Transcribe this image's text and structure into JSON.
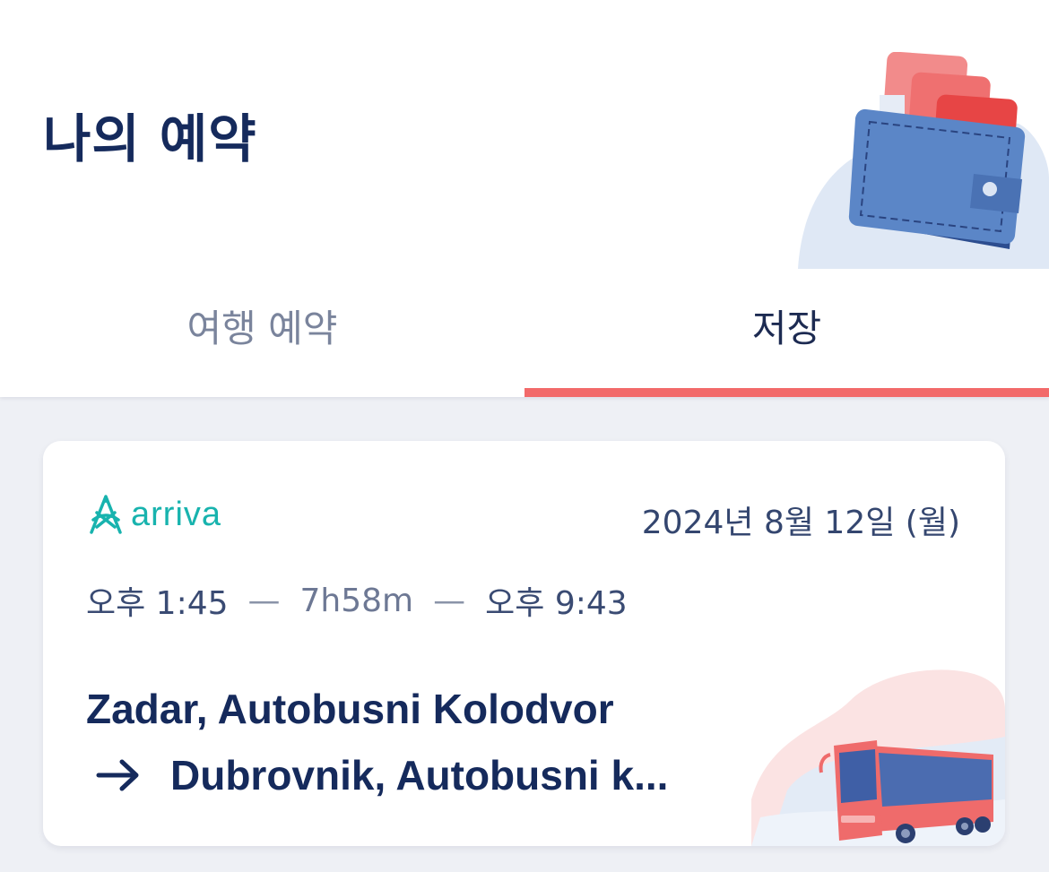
{
  "header": {
    "title": "나의 예약"
  },
  "tabs": [
    {
      "label": "여행 예약",
      "active": false
    },
    {
      "label": "저장",
      "active": true
    }
  ],
  "colors": {
    "accent": "#f26a6a",
    "navy": "#152a5c",
    "operator_teal": "#18b3ae",
    "background": "#eef0f5"
  },
  "booking": {
    "operator": {
      "name": "arriva",
      "logo_icon": "arriva-logo-icon"
    },
    "date": "2024년 8월 12일 (월)",
    "departure_time": "오후 1:45",
    "duration": "7h58m",
    "arrival_time": "오후 9:43",
    "separator": "—",
    "from": "Zadar, Autobusni Kolodvor",
    "to": "Dubrovnik, Autobusni k..."
  }
}
